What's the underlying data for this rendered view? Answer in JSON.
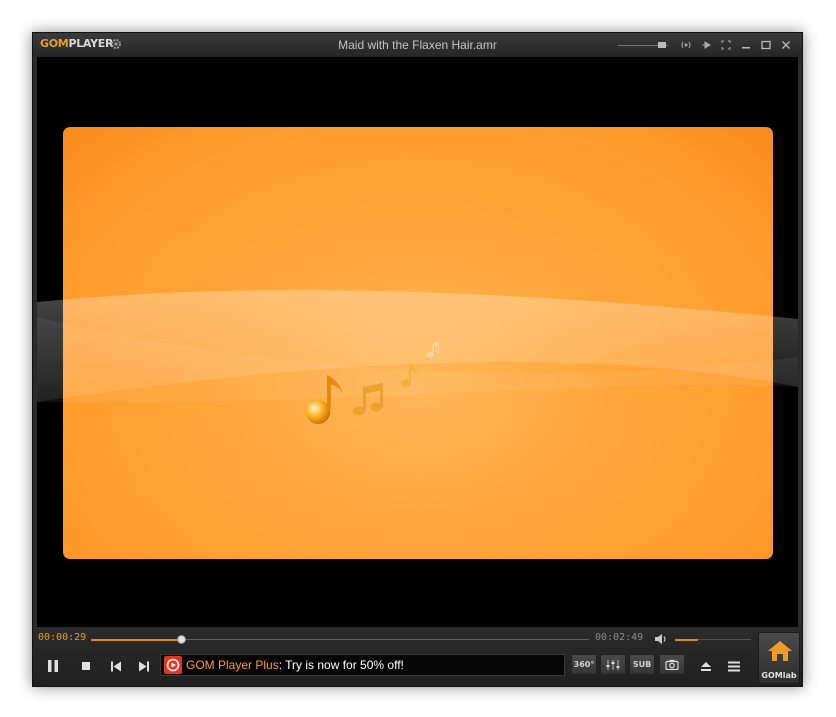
{
  "titlebar": {
    "logo_gom": "GOM",
    "logo_player": "PLAYER",
    "title": "Maid with the Flaxen Hair.amr"
  },
  "playback": {
    "current_time": "00:00:29",
    "total_time": "00:02:49",
    "progress_fraction": 0.18,
    "volume_fraction": 0.3
  },
  "ad": {
    "brand": "GOM Player Plus",
    "text": ": Try is now for 50% off!"
  },
  "buttons": {
    "vr360": "360°",
    "sub": "SUB",
    "gomlab": "GOMlab"
  },
  "colors": {
    "accent": "#e49b2b",
    "art_orange": "#ffa63a"
  }
}
